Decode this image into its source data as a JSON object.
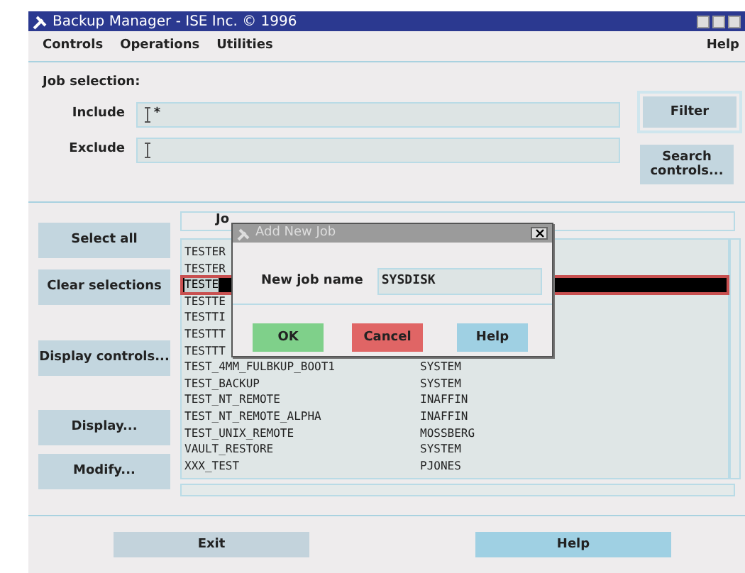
{
  "window": {
    "title": "Backup Manager - ISE Inc. © 1996"
  },
  "menu": [
    {
      "label": "Controls"
    },
    {
      "label": "Operations"
    },
    {
      "label": "Utilities"
    }
  ],
  "menu_right": {
    "label": "Help"
  },
  "job_selection": {
    "label": "Job selection:",
    "fields": [
      {
        "label": "Include",
        "value": "*"
      },
      {
        "label": "Exclude"
      }
    ]
  },
  "side_buttons": [
    {
      "label": "Filter",
      "framed": true
    },
    {
      "label": "Search controls...",
      "framed": false
    }
  ],
  "left_buttons": [
    "Select all",
    "Clear selections",
    "Display controls...",
    "Display...",
    "Modify..."
  ],
  "job_list": {
    "columns": [
      "Jo"
    ],
    "rows": [
      {
        "name": "TESTER",
        "selected": false
      },
      {
        "name": "TESTER",
        "selected": false
      },
      {
        "name": "TESTE",
        "selected": true
      },
      {
        "name": "TESTTE",
        "selected": false
      },
      {
        "name": "TESTTI",
        "selected": false
      },
      {
        "name": "TESTTT",
        "selected": false
      },
      {
        "name": "TESTTT",
        "selected": false
      },
      {
        "name": "TEST_4MM_FULBKUP_BOOT1",
        "owner": "SYSTEM",
        "selected": false
      },
      {
        "name": "TEST_BACKUP",
        "owner": "SYSTEM",
        "selected": false
      },
      {
        "name": "TEST_NT_REMOTE",
        "owner": "INAFFIN",
        "selected": false
      },
      {
        "name": "TEST_NT_REMOTE_ALPHA",
        "owner": "INAFFIN",
        "selected": false
      },
      {
        "name": "TEST_UNIX_REMOTE",
        "owner": "MOSSBERG",
        "selected": false
      },
      {
        "name": "VAULT_RESTORE",
        "owner": "SYSTEM",
        "selected": false
      },
      {
        "name": "XXX_TEST",
        "owner": "PJONES",
        "selected": false
      }
    ]
  },
  "bottom_buttons": [
    {
      "label": "Exit",
      "kind": "plain"
    },
    {
      "label": "Help",
      "kind": "help"
    }
  ],
  "dialog": {
    "title": "Add New Job",
    "field_label": "New job name",
    "value": "SYSDISK",
    "buttons": [
      {
        "label": "OK",
        "kind": "ok"
      },
      {
        "label": "Cancel",
        "kind": "cancel"
      },
      {
        "label": "Help",
        "kind": "help"
      }
    ]
  }
}
